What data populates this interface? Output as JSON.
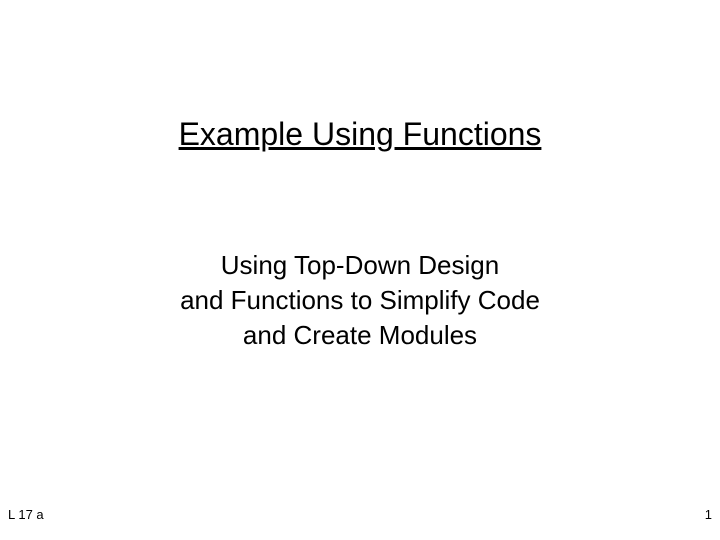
{
  "slide": {
    "title": "Example Using Functions",
    "subtitle_line1": "Using Top-Down Design",
    "subtitle_line2": "and Functions to Simplify Code",
    "subtitle_line3": "and Create Modules",
    "footer_left": "L 17 a",
    "footer_right": "1"
  }
}
